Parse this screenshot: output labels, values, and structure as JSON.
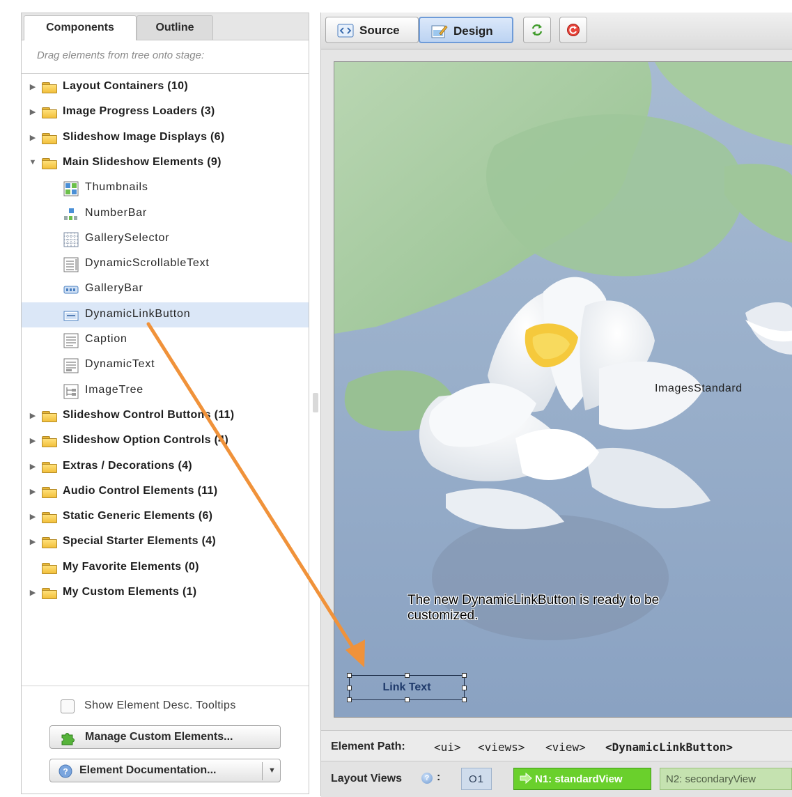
{
  "left_panel": {
    "tabs": [
      "Components",
      "Outline"
    ],
    "drag_hint": "Drag elements from tree onto stage:",
    "tree": [
      {
        "kind": "category",
        "label": "Layout Containers (10)",
        "arrow": "▶"
      },
      {
        "kind": "category",
        "label": "Image Progress Loaders (3)",
        "arrow": "▶"
      },
      {
        "kind": "category",
        "label": "Slideshow Image Displays (6)",
        "arrow": "▶"
      },
      {
        "kind": "category",
        "label": "Main Slideshow Elements (9)",
        "arrow": "▼",
        "expanded": true
      },
      {
        "kind": "item",
        "label": "Thumbnails",
        "icon": "thumbnails-icon"
      },
      {
        "kind": "item",
        "label": "NumberBar",
        "icon": "numberbar-icon"
      },
      {
        "kind": "item",
        "label": "GallerySelector",
        "icon": "gallery-selector-icon"
      },
      {
        "kind": "item",
        "label": "DynamicScrollableText",
        "icon": "scrollable-text-icon"
      },
      {
        "kind": "item",
        "label": "GalleryBar",
        "icon": "gallerybar-icon"
      },
      {
        "kind": "item",
        "label": "DynamicLinkButton",
        "icon": "link-button-icon",
        "selected": true
      },
      {
        "kind": "item",
        "label": "Caption",
        "icon": "caption-icon"
      },
      {
        "kind": "item",
        "label": "DynamicText",
        "icon": "dynamic-text-icon"
      },
      {
        "kind": "item",
        "label": "ImageTree",
        "icon": "image-tree-icon"
      },
      {
        "kind": "category",
        "label": "Slideshow Control Buttons (11)",
        "arrow": "▶"
      },
      {
        "kind": "category",
        "label": "Slideshow Option Controls (4)",
        "arrow": "▶"
      },
      {
        "kind": "category",
        "label": "Extras / Decorations (4)",
        "arrow": "▶"
      },
      {
        "kind": "category",
        "label": "Audio Control Elements (11)",
        "arrow": "▶"
      },
      {
        "kind": "category",
        "label": "Static Generic Elements (6)",
        "arrow": "▶"
      },
      {
        "kind": "category",
        "label": "Special Starter Elements (4)",
        "arrow": "▶"
      },
      {
        "kind": "category",
        "label": "My Favorite Elements (0)",
        "arrow": ""
      },
      {
        "kind": "category",
        "label": "My Custom Elements (1)",
        "arrow": "▶"
      }
    ],
    "show_tooltips_label": "Show Element Desc. Tooltips",
    "show_tooltips_checked": false,
    "manage_button": "Manage Custom Elements...",
    "doc_button": "Element Documentation...",
    "doc_dropdown_arrow": "▼"
  },
  "toolbar": {
    "source_label": "Source",
    "design_label": "Design",
    "active_mode": "Design"
  },
  "stage": {
    "element_label": "ImagesStandard",
    "caption": "The new DynamicLinkButton is ready to be customized.",
    "link_button_text": "Link Text"
  },
  "path_bar": {
    "label": "Element Path:",
    "tags": [
      "<ui>",
      "<views>",
      "<view>",
      "<DynamicLinkButton>"
    ]
  },
  "views_bar": {
    "label": "Layout Views",
    "colon": ":",
    "help_glyph": "?",
    "o1": "O1",
    "n1": "N1: standardView",
    "n2": "N2: secondaryView"
  },
  "colors": {
    "selection": "#dbe7f7",
    "folder": "#f2bf3b",
    "n1_active": "#6ad02c",
    "n2": "#c5e2b0",
    "annotation_arrow": "#f0923a",
    "stage_water": "#8ea6c6"
  }
}
